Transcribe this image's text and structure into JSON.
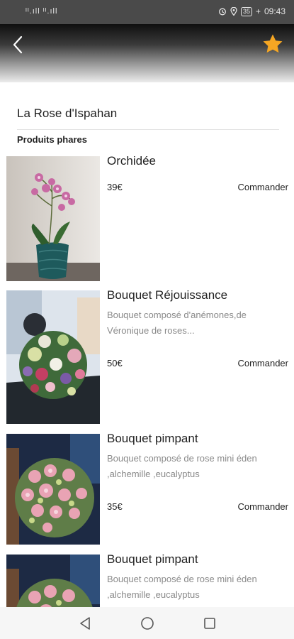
{
  "status_bar": {
    "signal": "ᴵᴵ.ıll ᴵᴵ.ıll",
    "battery": "35",
    "time": "09:43"
  },
  "header": {
    "back_icon": "chevron-left-icon",
    "favorite_icon": "star-icon",
    "star_color": "#f5a623"
  },
  "shop": {
    "name": "La Rose d'Ispahan",
    "section_title": "Produits phares"
  },
  "products": [
    {
      "name": "Orchidée",
      "description": "",
      "price": "39€",
      "order_label": "Commander"
    },
    {
      "name": "Bouquet Réjouissance",
      "description": "Bouquet composé d'anémones,de Véronique de roses...",
      "price": "50€",
      "order_label": "Commander"
    },
    {
      "name": "Bouquet pimpant",
      "description": "Bouquet composé de rose mini éden ,alchemille ,eucalyptus",
      "price": "35€",
      "order_label": "Commander"
    },
    {
      "name": "Bouquet pimpant",
      "description": "Bouquet composé de rose mini éden ,alchemille ,eucalyptus",
      "price": "",
      "order_label": ""
    }
  ],
  "nav": {
    "back": "triangle-back-icon",
    "home": "circle-home-icon",
    "recents": "square-recents-icon"
  }
}
